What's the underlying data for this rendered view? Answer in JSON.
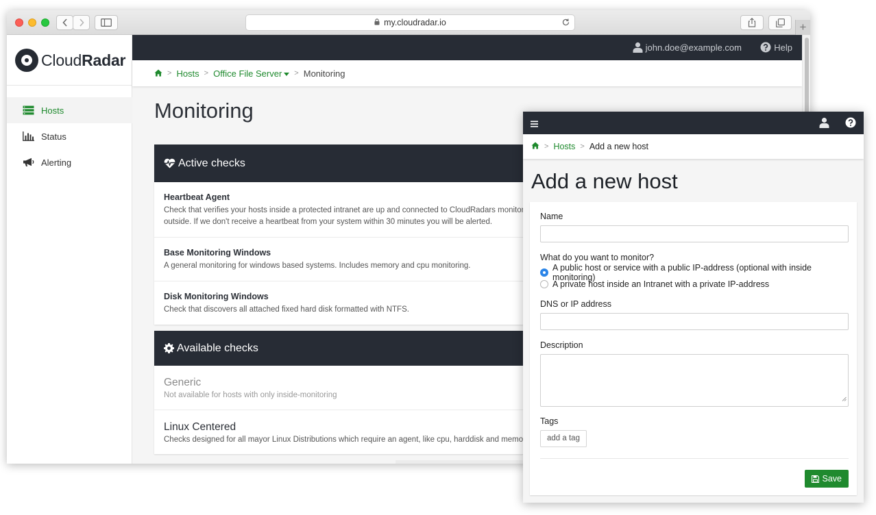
{
  "browser": {
    "url": "my.cloudradar.io"
  },
  "brand": {
    "name_light": "Cloud",
    "name_bold": "Radar"
  },
  "sidebar": {
    "items": [
      {
        "label": "Hosts",
        "icon": "server-icon",
        "active": true
      },
      {
        "label": "Status",
        "icon": "bar-chart-icon",
        "active": false
      },
      {
        "label": "Alerting",
        "icon": "bullhorn-icon",
        "active": false
      }
    ]
  },
  "topbar": {
    "user": "john.doe@example.com",
    "help": "Help"
  },
  "breadcrumb": {
    "hosts": "Hosts",
    "server": "Office File Server",
    "current": "Monitoring"
  },
  "page": {
    "title": "Monitoring"
  },
  "active_checks": {
    "title": "Active checks",
    "items": [
      {
        "title": "Heartbeat Agent",
        "desc_line1": "Check that verifies your hosts inside a protected intranet are up and connected to CloudRadars monitoring",
        "desc_line2": "outside. If we don't receive a heartbeat from your system within 30 minutes you will be alerted."
      },
      {
        "title": "Base Monitoring Windows",
        "desc_line1": "A general monitoring for windows based systems. Includes memory and cpu monitoring."
      },
      {
        "title": "Disk Monitoring Windows",
        "desc_line1": "Check that discovers all attached fixed hard disk formatted with NTFS."
      }
    ]
  },
  "available_checks": {
    "title": "Available checks",
    "items": [
      {
        "title": "Generic",
        "desc": "Not available for hosts with only inside-monitoring",
        "disabled": true
      },
      {
        "title": "Linux Centered",
        "desc": "Checks designed for all mayor Linux Distributions which require an agent, like cpu, harddisk and memory.",
        "disabled": false
      }
    ]
  },
  "mobile": {
    "breadcrumb": {
      "hosts": "Hosts",
      "current": "Add a new host"
    },
    "title": "Add a new host",
    "form": {
      "name_label": "Name",
      "monitor_question": "What do you want to monitor?",
      "option_public": "A public host or service with a public IP-address (optional with inside monitoring)",
      "option_private": "A private host inside an Intranet with a private IP-address",
      "selected_option": "public",
      "dns_label": "DNS or IP address",
      "description_label": "Description",
      "tags_label": "Tags",
      "tag_placeholder": "add a tag",
      "save_label": "Save"
    }
  },
  "colors": {
    "dark": "#272c35",
    "accent_green": "#1f8a2e",
    "radio_blue": "#2b85e8"
  }
}
